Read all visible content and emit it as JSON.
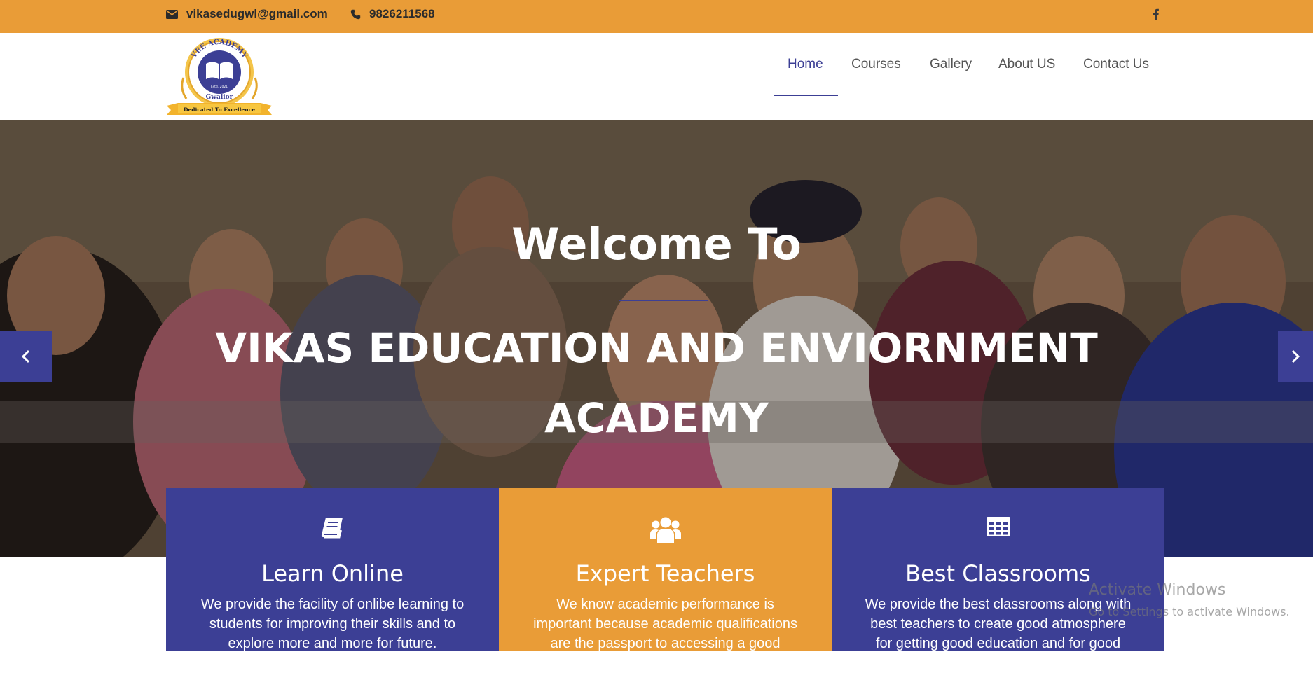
{
  "topbar": {
    "email": "vikasedugwl@gmail.com",
    "phone": "9826211568",
    "social_icon": "facebook-icon"
  },
  "logo": {
    "ring_text": "VEE ACADEMY",
    "est_text": "Estd. 2021",
    "city_text": "Gwalior",
    "ribbon_text": "Dedicated To Excellence"
  },
  "nav": {
    "items": [
      {
        "label": "Home",
        "active": true
      },
      {
        "label": "Courses",
        "active": false
      },
      {
        "label": "Gallery",
        "active": false
      },
      {
        "label": "About US",
        "active": false
      },
      {
        "label": "Contact Us",
        "active": false
      }
    ]
  },
  "hero": {
    "welcome": "Welcome To",
    "title": "VIKAS EDUCATION AND ENVIORNMENT ACADEMY",
    "accent_color": "#3c3f95"
  },
  "cards": [
    {
      "icon": "book-icon",
      "title": "Learn Online",
      "text": "We provide the facility of onlibe learning to students for improving their skills and to explore more and more for future."
    },
    {
      "icon": "users-icon",
      "title": "Expert Teachers",
      "text": "We know academic performance is important because academic qualifications are the passport to accessing a good career."
    },
    {
      "icon": "table-icon",
      "title": "Best Classrooms",
      "text": "We provide the best classrooms along with best teachers to create good atmosphere for getting good education and for good future."
    }
  ],
  "windows_notice": {
    "title": "Activate Windows",
    "subtitle": "Go to Settings to activate Windows."
  },
  "colors": {
    "brand_orange": "#e99c37",
    "brand_blue": "#3c3f95"
  }
}
